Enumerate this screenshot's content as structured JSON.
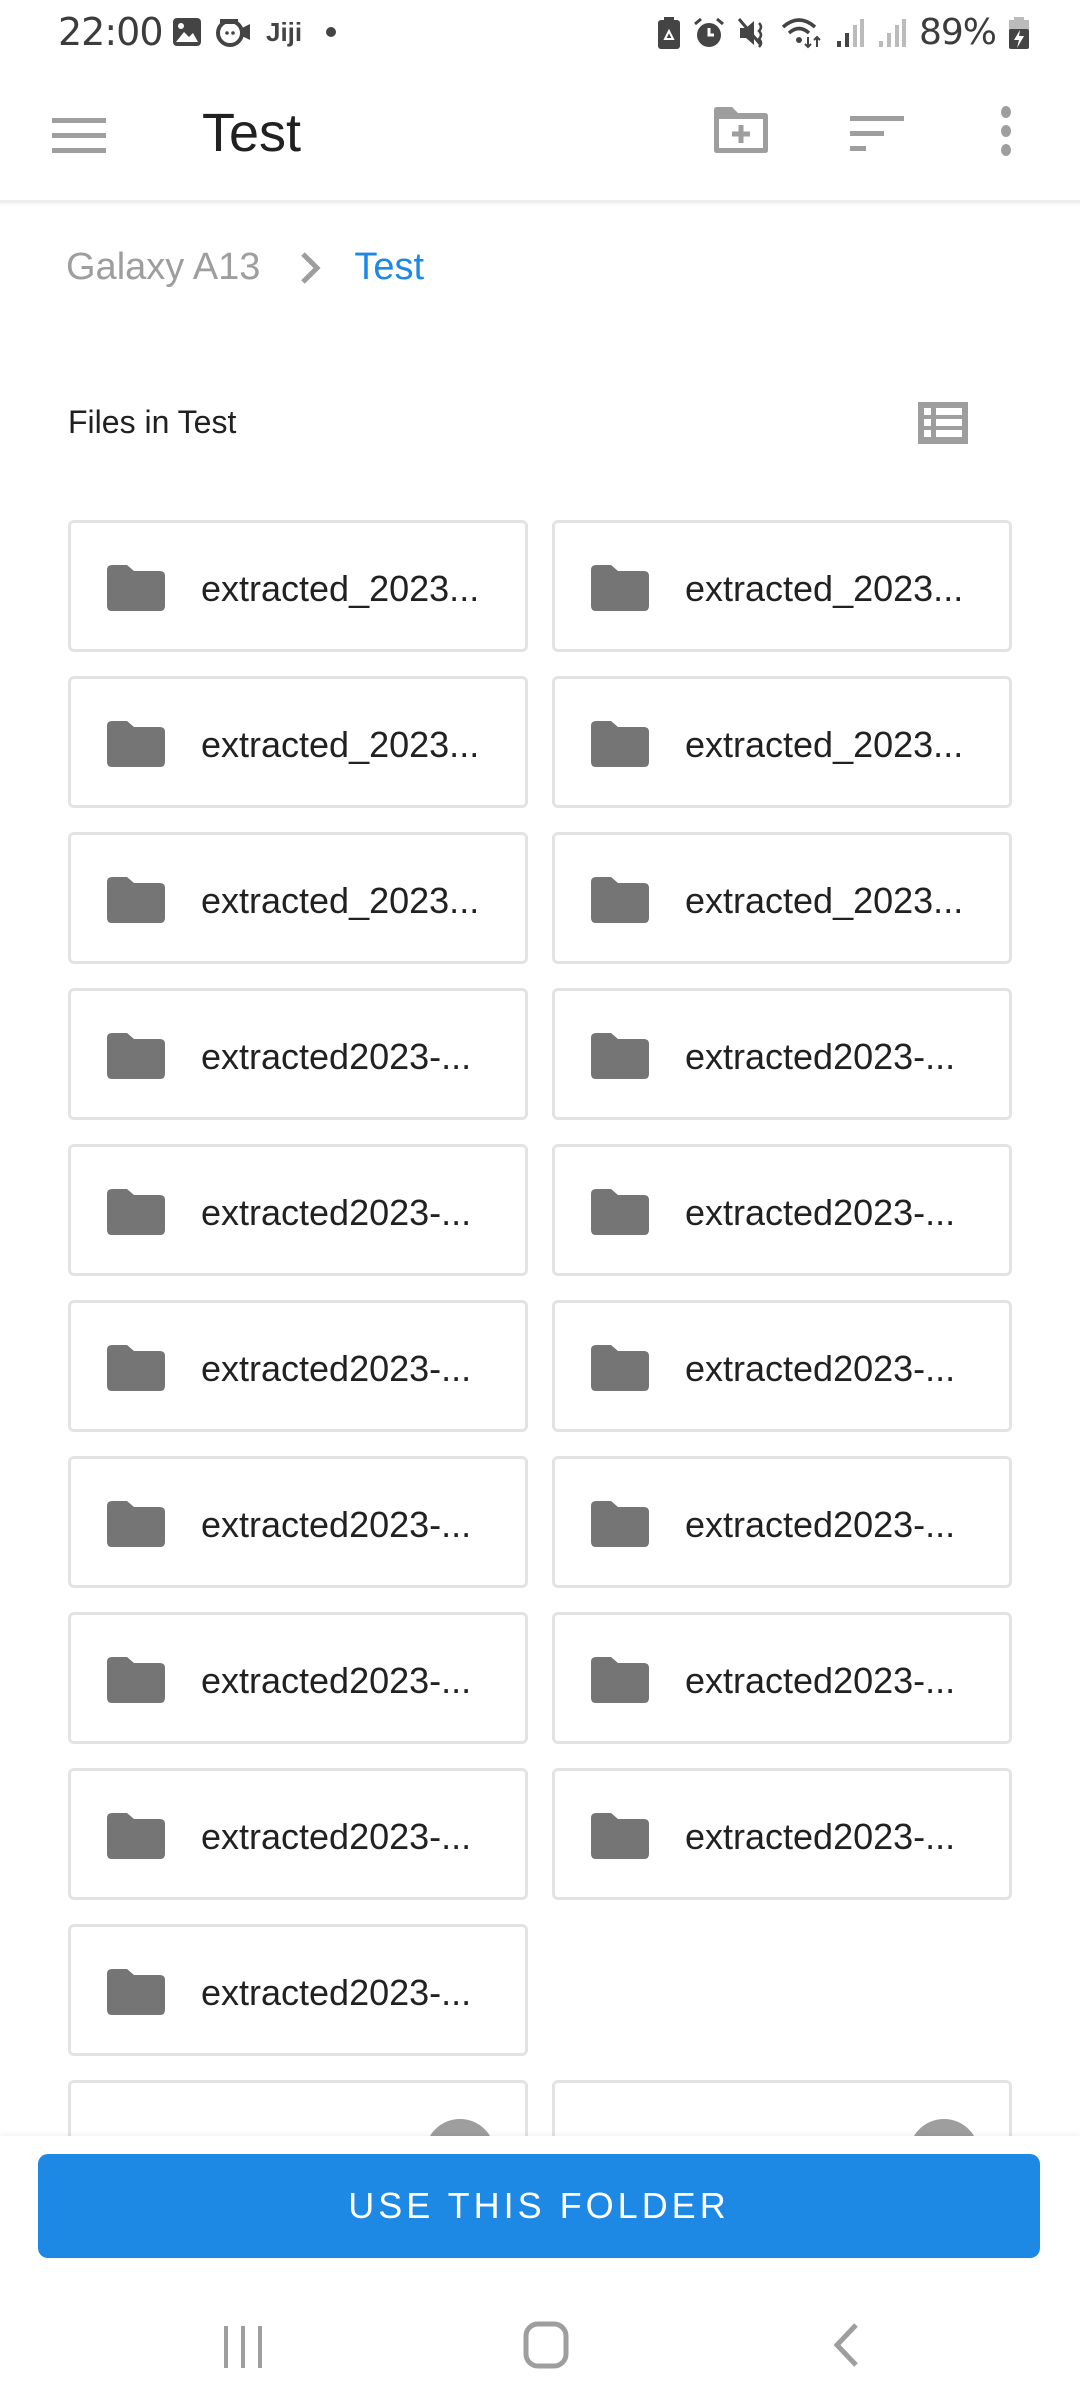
{
  "status_bar": {
    "time": "22:00",
    "left_icons": [
      "gallery-icon",
      "video-face-icon",
      "jiji-app-icon",
      "notification-dot-icon"
    ],
    "jiji_label": "Jiji",
    "right_icons": [
      "battery-saver-icon",
      "alarm-icon",
      "mute-icon",
      "wifi-icon",
      "signal-1-icon",
      "signal-2-icon",
      "battery-charging-icon"
    ],
    "battery_percent": "89%"
  },
  "app_bar": {
    "title": "Test",
    "menu_icon": "hamburger-icon",
    "actions": [
      "new-folder-icon",
      "sort-icon",
      "more-vert-icon"
    ]
  },
  "breadcrumb": {
    "root": "Galaxy A13",
    "separator_icon": "chevron-right-icon",
    "current": "Test"
  },
  "section": {
    "title": "Files in Test",
    "view_toggle_icon": "list-view-icon"
  },
  "folders": [
    {
      "name": "extracted_2023..."
    },
    {
      "name": "extracted_2023..."
    },
    {
      "name": "extracted_2023..."
    },
    {
      "name": "extracted_2023..."
    },
    {
      "name": "extracted_2023..."
    },
    {
      "name": "extracted_2023..."
    },
    {
      "name": "extracted2023-..."
    },
    {
      "name": "extracted2023-..."
    },
    {
      "name": "extracted2023-..."
    },
    {
      "name": "extracted2023-..."
    },
    {
      "name": "extracted2023-..."
    },
    {
      "name": "extracted2023-..."
    },
    {
      "name": "extracted2023-..."
    },
    {
      "name": "extracted2023-..."
    },
    {
      "name": "extracted2023-..."
    },
    {
      "name": "extracted2023-..."
    },
    {
      "name": "extracted2023-..."
    },
    {
      "name": "extracted2023-..."
    },
    {
      "name": "extracted2023-..."
    }
  ],
  "partial_files": [
    {
      "thumbnail_icon": "archive-file-icon"
    },
    {
      "thumbnail_icon": "archive-file-icon"
    }
  ],
  "primary_action": {
    "label": "USE THIS FOLDER",
    "color": "#1e88e5"
  },
  "nav_bar": {
    "buttons": [
      "recents-icon",
      "home-icon",
      "back-icon"
    ]
  }
}
